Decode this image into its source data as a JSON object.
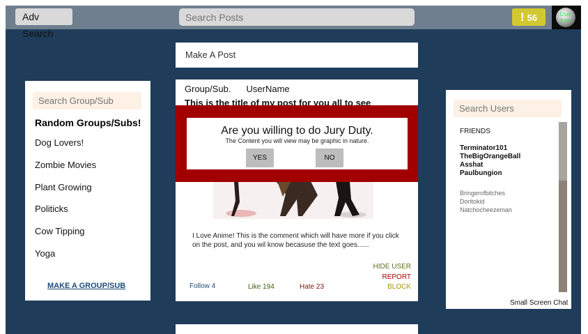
{
  "topbar": {
    "adv_search": "Adv Search",
    "search_posts_placeholder": "Search Posts",
    "notif_bang": "!",
    "notif_count": "56",
    "avatar_line1": "User",
    "avatar_line2": "Icon"
  },
  "make_post": "Make A Post",
  "left_panel": {
    "search_placeholder": "Search Group/Sub",
    "heading": "Random Groups/Subs!",
    "groups": [
      "Dog Lovers!",
      "Zombie Movies",
      "Plant Growing",
      "Politicks",
      "Cow Tipping",
      "Yoga"
    ],
    "make_group": "MAKE A GROUP/SUB"
  },
  "post": {
    "group": "Group/Sub.",
    "username": "UserName",
    "title": "This is the title of my post for you all to see",
    "comment": "I Love Anime! This is the comment which will have more if you click on the post, and you wil know becasuse the text goes......",
    "hide_user": "HIDE USER",
    "report": "REPORT",
    "block": "BLOCK",
    "follow": "Follow 4",
    "like": "Like 194",
    "hate": "Hate 23"
  },
  "jury": {
    "title": "Are you willing to do Jury Duty.",
    "subtitle": "The Content you will view may be graphic in nature.",
    "yes": "YES",
    "no": "NO"
  },
  "right_panel": {
    "search_placeholder": "Search Users",
    "friends_label": "FRIENDS",
    "online": [
      "Terminator101",
      "TheBigOrangeBall",
      "Asshat",
      "Paulbungion"
    ],
    "offline": [
      "Bringerofbitches",
      "Doritokid",
      "Natchocheezeman"
    ],
    "small_chat": "Small Screen Chat"
  },
  "colors": {
    "background": "#1f3c5a",
    "topbar": "#6f7f8f",
    "jury_band": "#a20000",
    "notif": "#d2c832"
  }
}
